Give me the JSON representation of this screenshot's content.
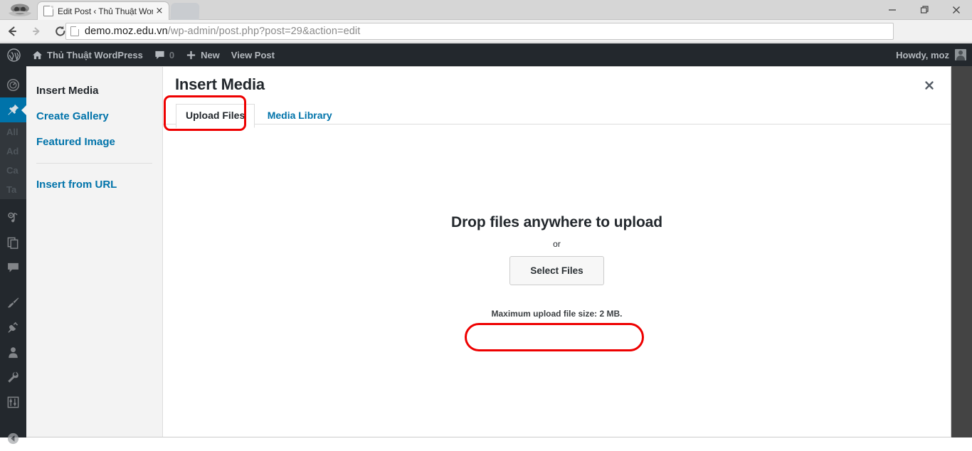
{
  "browser": {
    "incognito_icon": "incognito-icon",
    "tab": {
      "title": "Edit Post ‹ Thủ Thuật Wor",
      "favicon": "page-icon",
      "close": "×"
    },
    "nav": {
      "back": "back-arrow-icon",
      "forward": "forward-arrow-icon",
      "reload": "reload-icon"
    },
    "omnibox": {
      "url_domain": "demo.moz.edu.vn",
      "url_path": "/wp-admin/post.php?post=29&action=edit",
      "page_icon": "page-icon"
    },
    "toolbar_icons": [
      "translate-icon",
      "bookmark-star-icon",
      "profile-avatar-icon",
      "chrome-menu-icon"
    ],
    "window_controls": [
      "minimize",
      "maximize",
      "close"
    ]
  },
  "adminbar": {
    "wp_logo": "wordpress-logo-icon",
    "site_icon": "home-icon",
    "site_name": "Thủ Thuật WordPress",
    "comments_icon": "comment-bubble-icon",
    "comments_count": "0",
    "new_icon": "plus-icon",
    "new_label": "New",
    "view_post_label": "View Post",
    "howdy": "Howdy, moz",
    "avatar": "user-avatar"
  },
  "admin_menu": {
    "items": [
      {
        "name": "dashboard",
        "icon": "dashboard-gauge-icon",
        "active": false
      },
      {
        "name": "posts",
        "icon": "pin-icon",
        "active": true
      },
      {
        "name": "media",
        "icon": "media-camera-icon",
        "active": false
      },
      {
        "name": "pages",
        "icon": "pages-icon",
        "active": false
      },
      {
        "name": "comments",
        "icon": "comment-bubble-icon",
        "active": false
      },
      {
        "name": "appearance",
        "icon": "paintbrush-icon",
        "active": false
      },
      {
        "name": "plugins",
        "icon": "plug-icon",
        "active": false
      },
      {
        "name": "users",
        "icon": "user-icon",
        "active": false
      },
      {
        "name": "tools",
        "icon": "wrench-icon",
        "active": false
      },
      {
        "name": "settings",
        "icon": "settings-sliders-icon",
        "active": false
      },
      {
        "name": "collapse-menu",
        "icon": "collapse-arrow-icon",
        "active": false
      }
    ],
    "submenu": [
      {
        "label": "All"
      },
      {
        "label": "Ad"
      },
      {
        "label": "Ca"
      },
      {
        "label": "Ta"
      }
    ]
  },
  "modal": {
    "title": "Insert Media",
    "close_icon": "close-icon",
    "sidebar": [
      {
        "label": "Insert Media",
        "current": true
      },
      {
        "label": "Create Gallery",
        "current": false
      },
      {
        "label": "Featured Image",
        "current": false
      },
      {
        "label": "Insert from URL",
        "current": false
      }
    ],
    "tabs": [
      {
        "label": "Upload Files",
        "active": true
      },
      {
        "label": "Media Library",
        "active": false
      }
    ],
    "uploader": {
      "drop_title": "Drop files anywhere to upload",
      "or": "or",
      "select_button": "Select Files",
      "max_size": "Maximum upload file size: 2 MB."
    }
  },
  "annotations": {
    "color": "#ee0000",
    "targets": [
      "upload-files-tab",
      "maximum-upload-file-size-text"
    ]
  }
}
